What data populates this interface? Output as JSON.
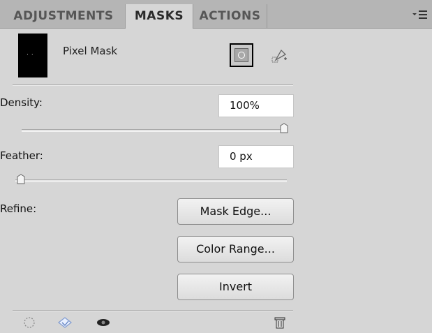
{
  "tabs": [
    {
      "label": "ADJUSTMENTS",
      "active": false
    },
    {
      "label": "MASKS",
      "active": true
    },
    {
      "label": "ACTIONS",
      "active": false
    }
  ],
  "panel_menu_icon": "panel-menu-icon",
  "mask": {
    "type_label": "Pixel Mask",
    "pixel_mask_icon": "pixel-mask-icon",
    "vector_mask_icon": "vector-mask-icon"
  },
  "density": {
    "label": "Density:",
    "value": "100%",
    "slider_fraction": 1.0
  },
  "feather": {
    "label": "Feather:",
    "value": "0 px",
    "slider_fraction": 0.0
  },
  "refine": {
    "label": "Refine:",
    "mask_edge_label": "Mask Edge...",
    "color_range_label": "Color Range...",
    "invert_label": "Invert"
  },
  "bottom_icons": [
    "load-selection-icon",
    "apply-mask-icon",
    "toggle-visibility-icon",
    "delete-mask-icon"
  ],
  "colors": {
    "panel_bg": "#d6d6d6",
    "tab_bar_bg": "#b5b5b5"
  }
}
